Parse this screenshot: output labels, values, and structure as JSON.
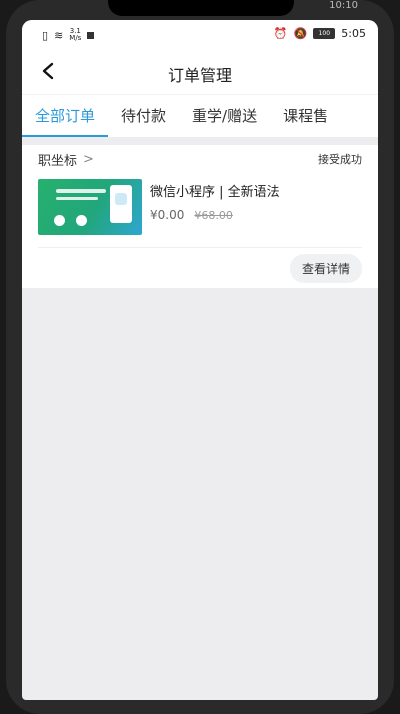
{
  "device": {
    "clock": "10:10"
  },
  "status_bar": {
    "net_speed_value": "3.1",
    "net_speed_unit": "M/s",
    "battery": "100",
    "time": "5:05"
  },
  "header": {
    "title": "订单管理"
  },
  "tabs": [
    {
      "label": "全部订单",
      "active": true
    },
    {
      "label": "待付款",
      "active": false
    },
    {
      "label": "重学/赠送",
      "active": false
    },
    {
      "label": "课程售",
      "active": false
    }
  ],
  "order": {
    "shop_name": "职坐标",
    "status": "接受成功",
    "goods": {
      "title": "微信小程序 | 全新语法",
      "price": "¥0.00",
      "original_price": "¥68.00"
    },
    "detail_button": "查看详情"
  },
  "colors": {
    "accent": "#2a9bd8",
    "page_bg": "#ededf0"
  }
}
